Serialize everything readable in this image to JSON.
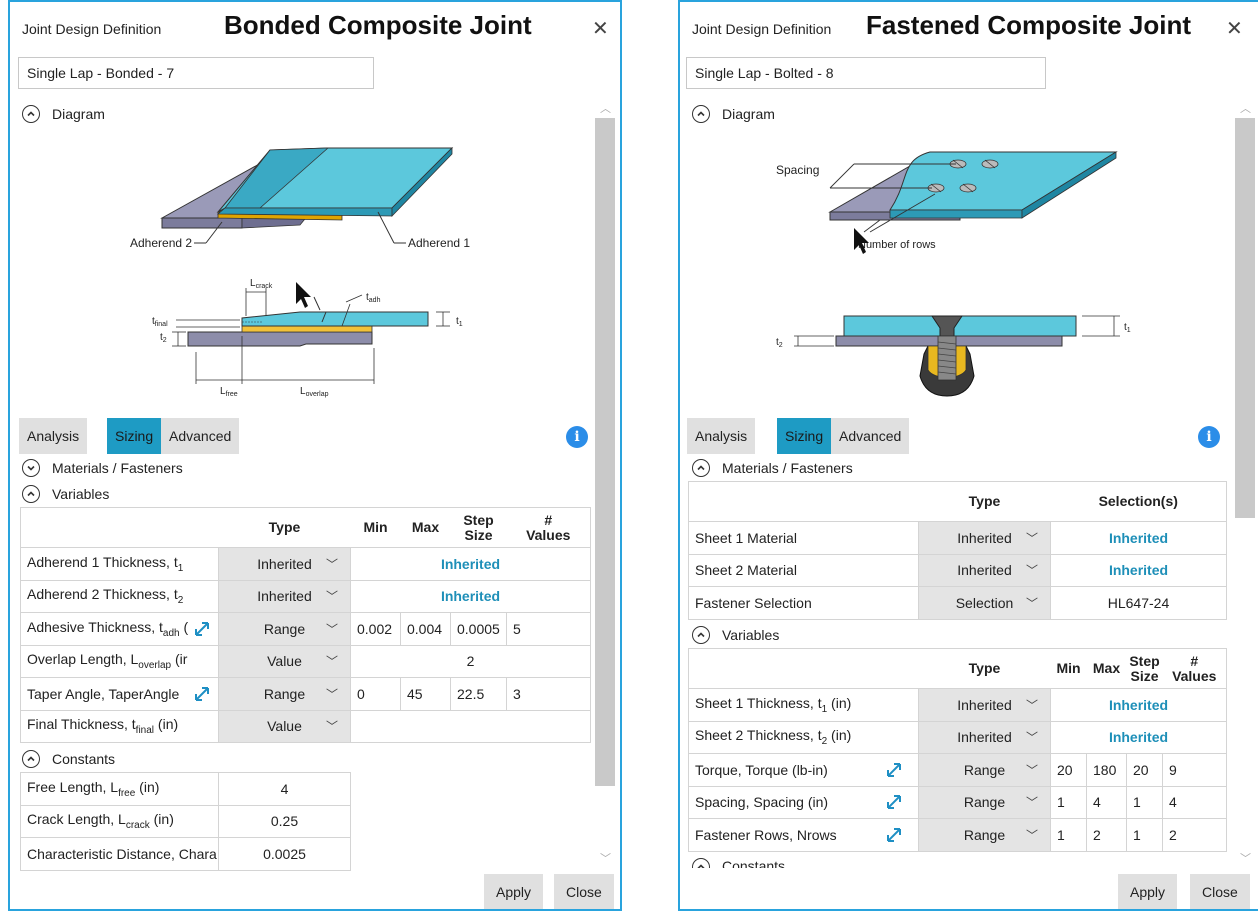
{
  "bonded": {
    "dialog_label": "Joint Design Definition",
    "title": "Bonded Composite Joint",
    "close_glyph": "✕",
    "name_value": "Single Lap - Bonded - 7",
    "diagram_label": "Diagram",
    "diagram_text": {
      "adherend2": "Adherend 2",
      "adherend1": "Adherend 1",
      "t_final": "t",
      "t_final_sub": "final",
      "t2": "t",
      "t2_sub": "2",
      "t1": "t",
      "t1_sub": "1",
      "l_crack": "L",
      "l_crack_sub": "crack",
      "t_adh": "t",
      "t_adh_sub": "adh",
      "l_free": "L",
      "l_free_sub": "free",
      "l_overlap": "L",
      "l_overlap_sub": "overlap"
    },
    "tabs": [
      "Analysis",
      "Sizing",
      "Advanced"
    ],
    "materials_label": "Materials / Fasteners",
    "variables_label": "Variables",
    "var_headers": {
      "type": "Type",
      "min": "Min",
      "max": "Max",
      "step1": "Step",
      "step2": "Size",
      "num1": "#",
      "num2": "Values"
    },
    "variables": [
      {
        "label": "Adherend 1 Thickness, t",
        "sub": "1",
        "tail": "",
        "type": "Inherited",
        "value": "Inherited"
      },
      {
        "label": "Adherend 2 Thickness, t",
        "sub": "2",
        "tail": "",
        "type": "Inherited",
        "value": "Inherited"
      },
      {
        "label": "Adhesive Thickness, t",
        "sub": "adh",
        "tail": " (",
        "type": "Range",
        "min": "0.002",
        "max": "0.004",
        "step": "0.0005",
        "num": "5"
      },
      {
        "label": "Overlap Length, L",
        "sub": "overlap",
        "tail": " (ir",
        "type": "Value",
        "value": "2"
      },
      {
        "label": "Taper Angle, TaperAngle",
        "sub": "",
        "tail": "",
        "type": "Range",
        "min": "0",
        "max": "45",
        "step": "22.5",
        "num": "3"
      },
      {
        "label": "Final Thickness, t",
        "sub": "final",
        "tail": " (in)",
        "type": "Value",
        "value": ""
      }
    ],
    "constants_label": "Constants",
    "constants": [
      {
        "label": "Free Length, L",
        "sub": "free",
        "tail": " (in)",
        "value": "4"
      },
      {
        "label": "Crack Length, L",
        "sub": "crack",
        "tail": " (in)",
        "value": "0.25"
      },
      {
        "label": "Characteristic Distance, Chara",
        "sub": "",
        "tail": "",
        "value": "0.0025"
      }
    ],
    "apply_label": "Apply",
    "close_label": "Close"
  },
  "fastened": {
    "dialog_label": "Joint Design Definition",
    "title": "Fastened Composite Joint",
    "close_glyph": "✕",
    "name_value": "Single Lap - Bolted - 8",
    "diagram_label": "Diagram",
    "diagram_text": {
      "spacing": "Spacing",
      "rows": "Number of rows",
      "t1": "t",
      "t1_sub": "1",
      "t2": "t",
      "t2_sub": "2"
    },
    "tabs": [
      "Analysis",
      "Sizing",
      "Advanced"
    ],
    "materials_label": "Materials / Fasteners",
    "mat_headers": {
      "type": "Type",
      "selection": "Selection(s)"
    },
    "materials": [
      {
        "label": "Sheet 1 Material",
        "type": "Inherited",
        "value": "Inherited"
      },
      {
        "label": "Sheet 2 Material",
        "type": "Inherited",
        "value": "Inherited"
      },
      {
        "label": "Fastener Selection",
        "type": "Selection",
        "value": "HL647-24"
      }
    ],
    "variables_label": "Variables",
    "var_headers": {
      "type": "Type",
      "min": "Min",
      "max": "Max",
      "step1": "Step",
      "step2": "Size",
      "num1": "#",
      "num2": "Values"
    },
    "variables": [
      {
        "label": "Sheet 1 Thickness, t",
        "sub": "1",
        "tail": " (in)",
        "type": "Inherited",
        "value": "Inherited"
      },
      {
        "label": "Sheet 2 Thickness, t",
        "sub": "2",
        "tail": " (in)",
        "type": "Inherited",
        "value": "Inherited"
      },
      {
        "label": "Torque, Torque (lb-in)",
        "sub": "",
        "tail": "",
        "type": "Range",
        "min": "20",
        "max": "180",
        "step": "20",
        "num": "9"
      },
      {
        "label": "Spacing, Spacing (in)",
        "sub": "",
        "tail": "",
        "type": "Range",
        "min": "1",
        "max": "4",
        "step": "1",
        "num": "4"
      },
      {
        "label": "Fastener Rows, Nrows",
        "sub": "",
        "tail": "",
        "type": "Range",
        "min": "1",
        "max": "2",
        "step": "1",
        "num": "2"
      }
    ],
    "constants_label": "Constants",
    "apply_label": "Apply",
    "close_label": "Close"
  },
  "colors": {
    "accent": "#29a3dd",
    "tab_active": "#1e9bc4",
    "inherited_text": "#1e8fb8",
    "info": "#2b8de8",
    "sheet_blue": "#4ec3d9",
    "adhesive": "#f2b705",
    "grey_sheet": "#8a8aa8"
  },
  "icons": {
    "collapse": "chevron-up-icon",
    "expand": "chevron-down-icon",
    "range": "expand-arrows-icon",
    "dropdown": "chevron-down-icon",
    "info": "info-icon"
  }
}
